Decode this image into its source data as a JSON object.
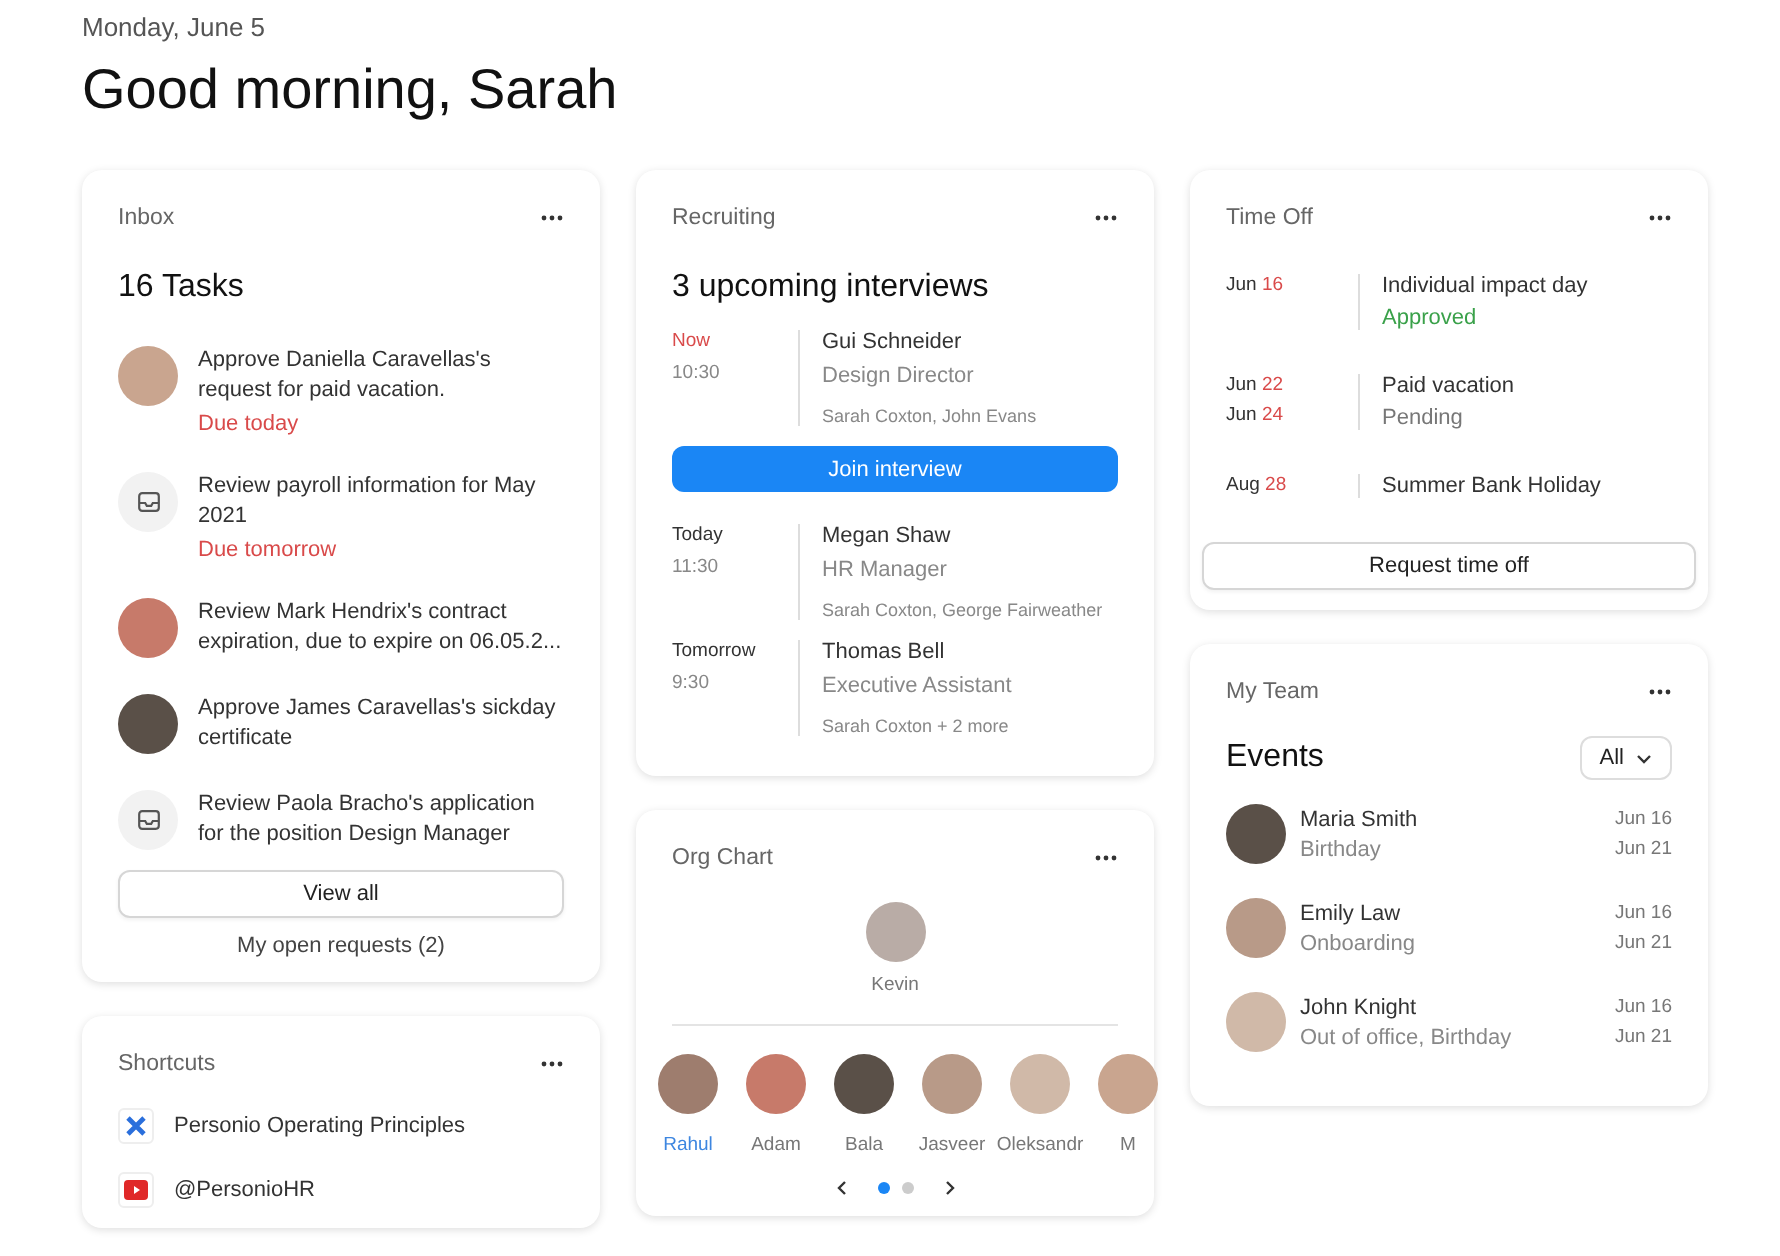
{
  "header": {
    "date": "Monday, June 5",
    "greeting": "Good morning, Sarah"
  },
  "inbox": {
    "title": "Inbox",
    "heading": "16 Tasks",
    "tasks": [
      {
        "kind": "avatar",
        "text": "Approve Daniella Caravellas's request for paid vacation.",
        "due": "Due today"
      },
      {
        "kind": "inbox",
        "text": "Review payroll information for May 2021",
        "due": "Due tomorrow"
      },
      {
        "kind": "avatar",
        "text": "Review Mark Hendrix's contract expiration, due to expire on 06.05.2..."
      },
      {
        "kind": "avatar",
        "text": "Approve James Caravellas's sickday certificate"
      },
      {
        "kind": "inbox",
        "text": "Review Paola Bracho's application for the position Design Manager"
      }
    ],
    "button": "View all",
    "link": "My open requests (2)"
  },
  "shortcuts": {
    "title": "Shortcuts",
    "items": [
      {
        "kind": "cross",
        "label": "Personio Operating Principles"
      },
      {
        "kind": "video",
        "label": "@PersonioHR"
      }
    ]
  },
  "recruiting": {
    "title": "Recruiting",
    "heading": "3 upcoming interviews",
    "interviews": [
      {
        "when": "Now",
        "live": true,
        "time": "10:30",
        "name": "Gui Schneider",
        "role": "Design Director",
        "panel": "Sarah Coxton, John Evans",
        "action": "Join interview"
      },
      {
        "when": "Today",
        "live": false,
        "time": "11:30",
        "name": "Megan Shaw",
        "role": "HR Manager",
        "panel": "Sarah Coxton, George Fairweather"
      },
      {
        "when": "Tomorrow",
        "live": false,
        "time": "9:30",
        "name": "Thomas Bell",
        "role": "Executive Assistant",
        "panel": "Sarah Coxton + 2 more"
      }
    ]
  },
  "org_chart": {
    "title": "Org Chart",
    "manager": "Kevin",
    "reports": [
      {
        "name": "Rahul",
        "selected": true
      },
      {
        "name": "Adam",
        "selected": false
      },
      {
        "name": "Bala",
        "selected": false
      },
      {
        "name": "Jasveer",
        "selected": false
      },
      {
        "name": "Oleksandr",
        "selected": false
      },
      {
        "name": "M",
        "selected": false
      }
    ],
    "pages": [
      {
        "selected": true
      },
      {
        "selected": false
      }
    ]
  },
  "time_off": {
    "title": "Time Off",
    "entries": [
      {
        "dates": [
          {
            "month": "Jun",
            "day": "16"
          }
        ],
        "label": "Individual impact day",
        "status": "Approved",
        "approved": true
      },
      {
        "dates": [
          {
            "month": "Jun",
            "day": "22"
          },
          {
            "month": "Jun",
            "day": "24"
          }
        ],
        "label": "Paid vacation",
        "status": "Pending",
        "approved": false
      },
      {
        "dates": [
          {
            "month": "Aug",
            "day": "28"
          }
        ],
        "label": "Summer Bank Holiday"
      }
    ],
    "button": "Request time off"
  },
  "my_team": {
    "title": "My Team",
    "heading": "Events",
    "filter": "All",
    "events": [
      {
        "name": "Maria Smith",
        "type": "Birthday",
        "dates": [
          "Jun 16",
          "Jun 21"
        ]
      },
      {
        "name": "Emily Law",
        "type": "Onboarding",
        "dates": [
          "Jun 16",
          "Jun 21"
        ]
      },
      {
        "name": "John Knight",
        "type": "Out of office, Birthday",
        "dates": [
          "Jun 16",
          "Jun 21"
        ]
      }
    ]
  }
}
